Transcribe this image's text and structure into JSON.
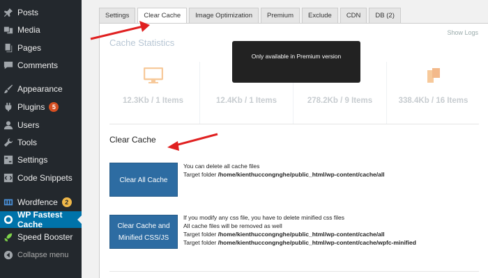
{
  "sidebar": {
    "items": [
      {
        "label": "Posts",
        "icon": "pin-icon"
      },
      {
        "label": "Media",
        "icon": "media-icon"
      },
      {
        "label": "Pages",
        "icon": "pages-icon"
      },
      {
        "label": "Comments",
        "icon": "comments-icon"
      },
      {
        "label": "Appearance",
        "icon": "paintbrush-icon"
      },
      {
        "label": "Plugins",
        "icon": "plugin-icon",
        "badge": "5"
      },
      {
        "label": "Users",
        "icon": "users-icon"
      },
      {
        "label": "Tools",
        "icon": "tools-icon"
      },
      {
        "label": "Settings",
        "icon": "settings-icon"
      },
      {
        "label": "Code Snippets",
        "icon": "code-icon"
      },
      {
        "label": "Wordfence",
        "icon": "wordfence-icon",
        "badge": "2"
      },
      {
        "label": "WP Fastest Cache",
        "icon": "cache-icon"
      },
      {
        "label": "Speed Booster",
        "icon": "rocket-icon"
      },
      {
        "label": "Collapse menu",
        "icon": "collapse-icon"
      }
    ]
  },
  "tabs": [
    "Settings",
    "Clear Cache",
    "Image Optimization",
    "Premium",
    "Exclude",
    "CDN",
    "DB (2)"
  ],
  "panel": {
    "show_logs": "Show Logs",
    "cache_stats_title": "Cache Statistics",
    "premium_tip": "Only available in Premium version",
    "stats": [
      "12.3Kb / 1 Items",
      "12.4Kb / 1 Items",
      "278.2Kb / 9 Items",
      "338.4Kb / 16 Items"
    ],
    "clear_title": "Clear Cache",
    "clear_all": {
      "button": "Clear All Cache",
      "line1": "You can delete all cache files",
      "line2_label": "Target folder ",
      "line2_path": "/home/kienthuccongnghe/public_html/wp-content/cache/all"
    },
    "clear_minified": {
      "button": "Clear Cache and Minified CSS/JS",
      "line1": "If you modify any css file, you have to delete minified css files",
      "line2": "All cache files will be removed as well",
      "line3_label": "Target folder ",
      "line3_path": "/home/kienthuccongnghe/public_html/wp-content/cache/all",
      "line4_label": "Target folder ",
      "line4_path": "/home/kienthuccongnghe/public_html/wp-content/cache/wpfc-minified"
    }
  },
  "colors": {
    "sidebar_bg": "#23282d",
    "active_menu": "#0073aa",
    "button_blue": "#2d6ca2",
    "arrow_red": "#e02020",
    "stat_icon_orange": "#f7c99a"
  }
}
